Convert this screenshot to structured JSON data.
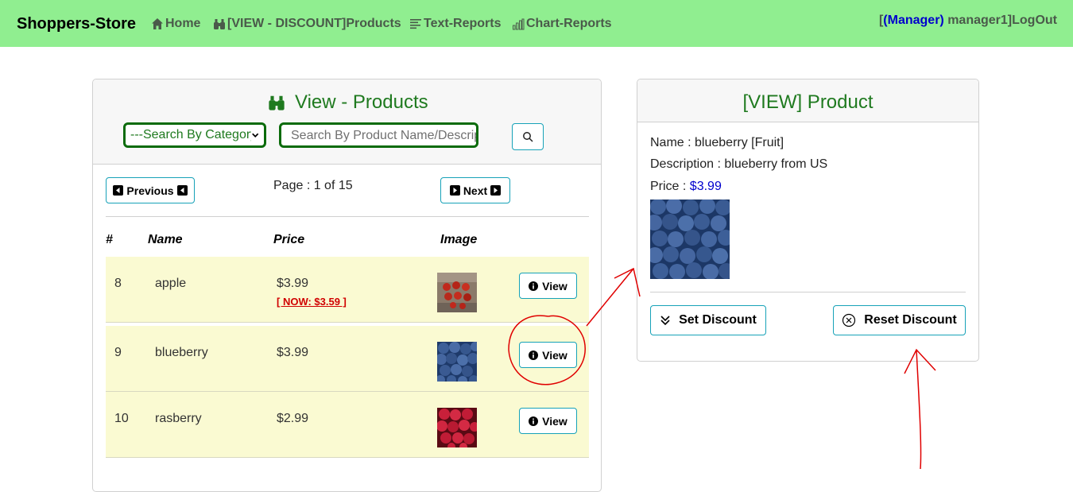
{
  "navbar": {
    "brand": "Shoppers-Store",
    "links": [
      {
        "label": "Home",
        "icon": "home-icon"
      },
      {
        "label": "[VIEW - DISCOUNT]Products",
        "icon": "binoculars-icon"
      },
      {
        "label": "Text-Reports",
        "icon": "text-report-icon"
      },
      {
        "label": "Chart-Reports",
        "icon": "bar-chart-icon"
      }
    ],
    "user_prefix": "[",
    "user_role": "(Manager)",
    "user_name": " manager1]",
    "logout": "LogOut"
  },
  "products_panel": {
    "title": "View - Products",
    "category_select": "---Search By Category---",
    "search_placeholder": "Search By Product Name/Description",
    "prev_label": "Previous",
    "next_label": "Next",
    "page_info": "Page : 1 of 15",
    "columns": [
      "#",
      "Name",
      "Price",
      "Image"
    ],
    "view_label": "View",
    "rows": [
      {
        "num": "8",
        "name": "apple",
        "price": "$3.99",
        "discount": "[ NOW: $3.59 ]"
      },
      {
        "num": "9",
        "name": "blueberry",
        "price": "$3.99",
        "discount": ""
      },
      {
        "num": "10",
        "name": "rasberry",
        "price": "$2.99",
        "discount": ""
      }
    ]
  },
  "detail_panel": {
    "title": "[VIEW] Product",
    "name_line": "Name : blueberry [Fruit]",
    "description_line": "Description : blueberry from US",
    "price_label": "Price : ",
    "price_value": "$3.99",
    "set_discount": "Set Discount",
    "reset_discount": "Reset Discount"
  },
  "colors": {
    "navbar_bg": "#90ee90",
    "title_green": "#1f7a1f",
    "row_bg": "#fafad2",
    "discount_red": "#d00000",
    "annotation_red": "#e00000",
    "button_border": "#17a2b8"
  }
}
